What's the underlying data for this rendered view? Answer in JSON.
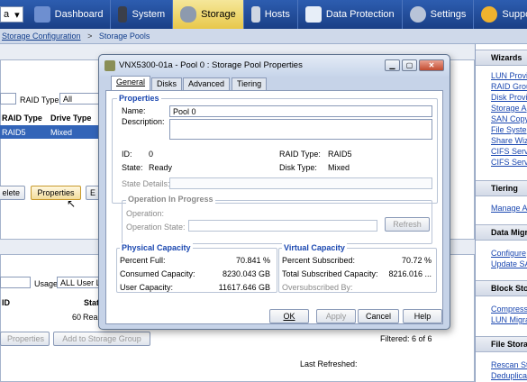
{
  "nav": {
    "partial_select": "a",
    "tabs": [
      {
        "label": "Dashboard",
        "icon": "dashboard-icon"
      },
      {
        "label": "System",
        "icon": "system-icon"
      },
      {
        "label": "Storage",
        "icon": "storage-icon"
      },
      {
        "label": "Hosts",
        "icon": "hosts-icon"
      },
      {
        "label": "Data Protection",
        "icon": "data-protection-icon"
      },
      {
        "label": "Settings",
        "icon": "settings-icon"
      },
      {
        "label": "Support",
        "icon": "support-icon"
      }
    ]
  },
  "breadcrumb": {
    "parent": "Storage Configuration",
    "sep": ">",
    "current": "Storage Pools"
  },
  "background": {
    "raid_type_label": "RAID Type",
    "raid_type_value": "All",
    "headers": [
      "RAID Type",
      "Drive Type"
    ],
    "selected_row": {
      "raid": "RAID5",
      "drive": "Mixed"
    },
    "buttons": [
      "elete",
      "Properties",
      "E"
    ],
    "usage_label": "Usage",
    "usage_value": "ALL User LU",
    "lower_headers": [
      "ID",
      "Stat"
    ],
    "lower_row": {
      "id": "60",
      "status": "Rea"
    },
    "lower_buttons": [
      "Properties",
      "Add to Storage Group"
    ],
    "filtered": "Filtered: 6 of 6",
    "last_refreshed": "Last Refreshed:"
  },
  "right_panel": {
    "sections": [
      {
        "title": "Wizards",
        "links": [
          "LUN Provi",
          "RAID Grou",
          "Disk Provi",
          "Storage A",
          "SAN Copy",
          "File Syste",
          "Share Wiz",
          "CIFS Serv",
          "CIFS Serv"
        ]
      },
      {
        "title": "Tiering",
        "links": [
          "Manage A"
        ]
      },
      {
        "title": "Data Migra",
        "links": [
          "Configure",
          "Update SA"
        ]
      },
      {
        "title": "Block Stor",
        "links": [
          "Compress",
          "LUN Migra"
        ]
      },
      {
        "title": "File Storag",
        "links": [
          "Rescan St",
          "Deduplica"
        ]
      }
    ]
  },
  "dialog": {
    "title": "VNX5300-01a - Pool 0 : Storage Pool Properties",
    "window_buttons": {
      "minimize": "▁",
      "restore": "▢",
      "close": "✕"
    },
    "tabs": [
      "General",
      "Disks",
      "Advanced",
      "Tiering"
    ],
    "properties": {
      "group_title": "Properties",
      "name_label": "Name:",
      "name_value": "Pool 0",
      "description_label": "Description:",
      "description_value": "",
      "id_label": "ID:",
      "id_value": "0",
      "raid_type_label": "RAID Type:",
      "raid_type_value": "RAID5",
      "state_label": "State:",
      "state_value": "Ready",
      "disk_type_label": "Disk Type:",
      "disk_type_value": "Mixed",
      "state_details_label": "State Details:",
      "state_details_value": ""
    },
    "operation": {
      "group_title": "Operation In Progress",
      "operation_label": "Operation:",
      "operation_state_label": "Operation State:",
      "operation_state_value": "",
      "refresh_label": "Refresh"
    },
    "physical": {
      "group_title": "Physical Capacity",
      "percent_full_label": "Percent Full:",
      "percent_full_value": "70.841 %",
      "consumed_label": "Consumed Capacity:",
      "consumed_value": "8230.043 GB",
      "user_label": "User Capacity:",
      "user_value": "11617.646 GB"
    },
    "virtual": {
      "group_title": "Virtual Capacity",
      "percent_subscribed_label": "Percent Subscribed:",
      "percent_subscribed_value": "70.72 %",
      "total_subscribed_label": "Total Subscribed Capacity:",
      "total_subscribed_value": "8216.016 ...",
      "oversubscribed_label": "Oversubscribed By:",
      "oversubscribed_value": ""
    },
    "buttons": {
      "ok": "OK",
      "apply": "Apply",
      "cancel": "Cancel",
      "help": "Help"
    }
  }
}
